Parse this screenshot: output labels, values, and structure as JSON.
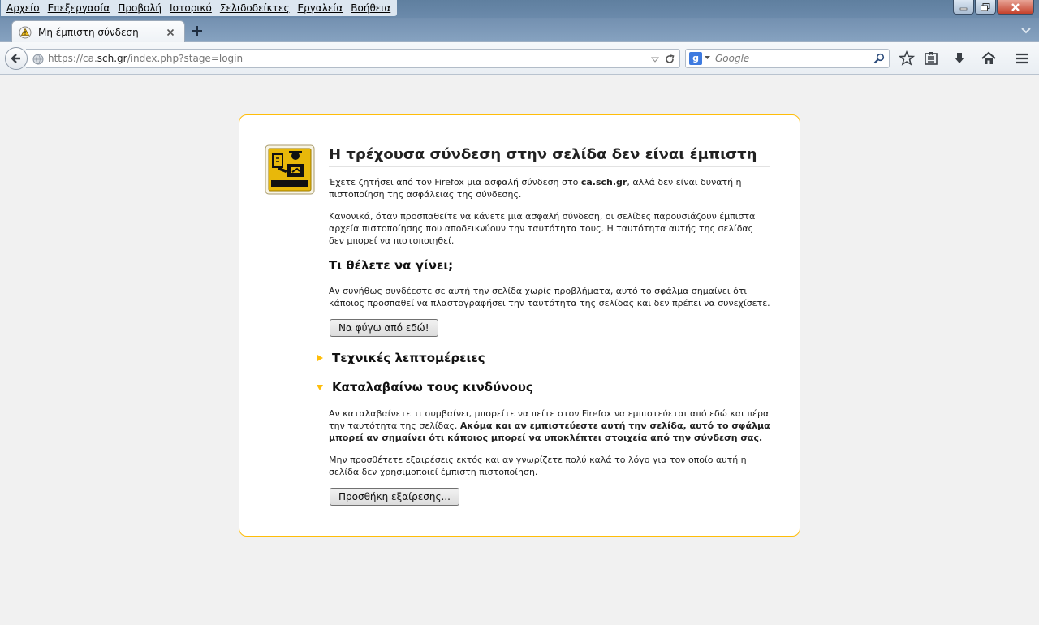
{
  "menubar": {
    "items": [
      "Αρχείο",
      "Επεξεργασία",
      "Προβολή",
      "Ιστορικό",
      "Σελιδοδείκτες",
      "Εργαλεία",
      "Βοήθεια"
    ]
  },
  "tab": {
    "title": "Μη έμπιστη σύνδεση",
    "icon": "warning-icon"
  },
  "navbar": {
    "url_prefix": "https://ca.",
    "url_host": "sch.gr",
    "url_suffix": "/index.php?stage=login",
    "search_placeholder": "Google"
  },
  "page": {
    "title": "Η τρέχουσα σύνδεση στην σελίδα δεν είναι έμπιστη",
    "intro_before": "Έχετε ζητήσει από τον Firefox μια ασφαλή σύνδεση στο ",
    "intro_host": "ca.sch.gr",
    "intro_after": ", αλλά δεν είναι δυνατή η πιστοποίηση της ασφάλειας της σύνδεσης.",
    "normally": "Κανονικά, όταν προσπαθείτε να κάνετε μια ασφαλή σύνδεση, οι σελίδες παρουσιάζουν έμπιστα αρχεία πιστοποίησης που αποδεικνύουν την ταυτότητα τους. Η ταυτότητα αυτής της σελίδας δεν μπορεί να πιστοποιηθεί.",
    "what_heading": "Τι θέλετε να γίνει;",
    "what_text": "Αν συνήθως συνδέεστε σε αυτή την σελίδα χωρίς προβλήματα, αυτό το σφάλμα σημαίνει ότι κάποιος προσπαθεί να πλαστογραφήσει την ταυτότητα της σελίδας και δεν πρέπει να συνεχίσετε.",
    "get_me_out_button": "Να φύγω από εδώ!",
    "technical_details": "Τεχνικές λεπτομέρειες",
    "understand_risks": "Καταλαβαίνω τους κινδύνους",
    "risks_text_plain": "Αν καταλαβαίνετε τι συμβαίνει, μπορείτε να πείτε στον Firefox να εμπιστεύεται από εδώ και πέρα την ταυτότητα της σελίδας. ",
    "risks_text_bold": "Ακόμα και αν εμπιστεύεστε αυτή την σελίδα, αυτό το σφάλμα μπορεί αν σημαίνει ότι κάποιος μπορεί να υποκλέπτει στοιχεία από την σύνδεση σας.",
    "exceptions_text": "Μην προσθέτετε εξαιρέσεις εκτός και αν γνωρίζετε πολύ καλά το λόγο για τον οποίο αυτή η σελίδα δεν χρησιμοποιεί έμπιστη πιστοποίηση.",
    "add_exception_button": "Προσθήκη εξαίρεσης..."
  },
  "colors": {
    "card_border": "#ffbd09",
    "icon_yellow": "#e8b80a"
  }
}
